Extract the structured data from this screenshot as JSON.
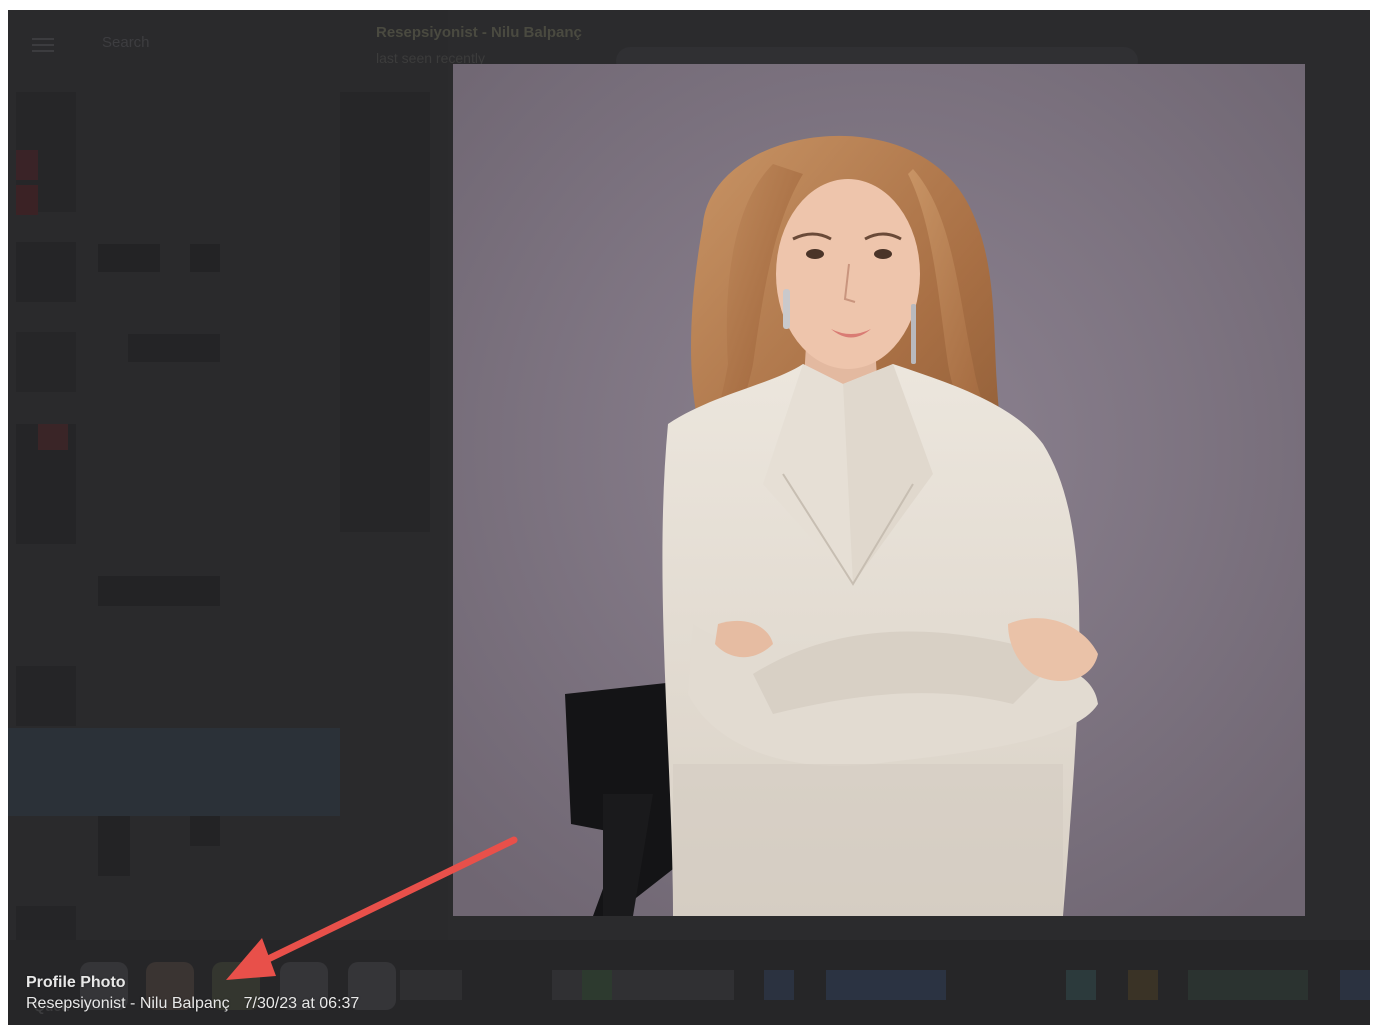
{
  "background_app": {
    "search_placeholder": "Search",
    "chat_title": "Resepsiyonist - Nilu Balpanç",
    "chat_subtitle": "last seen recently",
    "queue_label": "Queu"
  },
  "viewer": {
    "caption_title": "Profile Photo",
    "caption_sender": "Resepsiyonist - Nilu Balpanç",
    "caption_date": "7/30/23 at 06:37"
  },
  "annotation": {
    "arrow_color": "#e8504a"
  },
  "icons": [
    "hamburger-icon",
    "annotation-arrow"
  ]
}
